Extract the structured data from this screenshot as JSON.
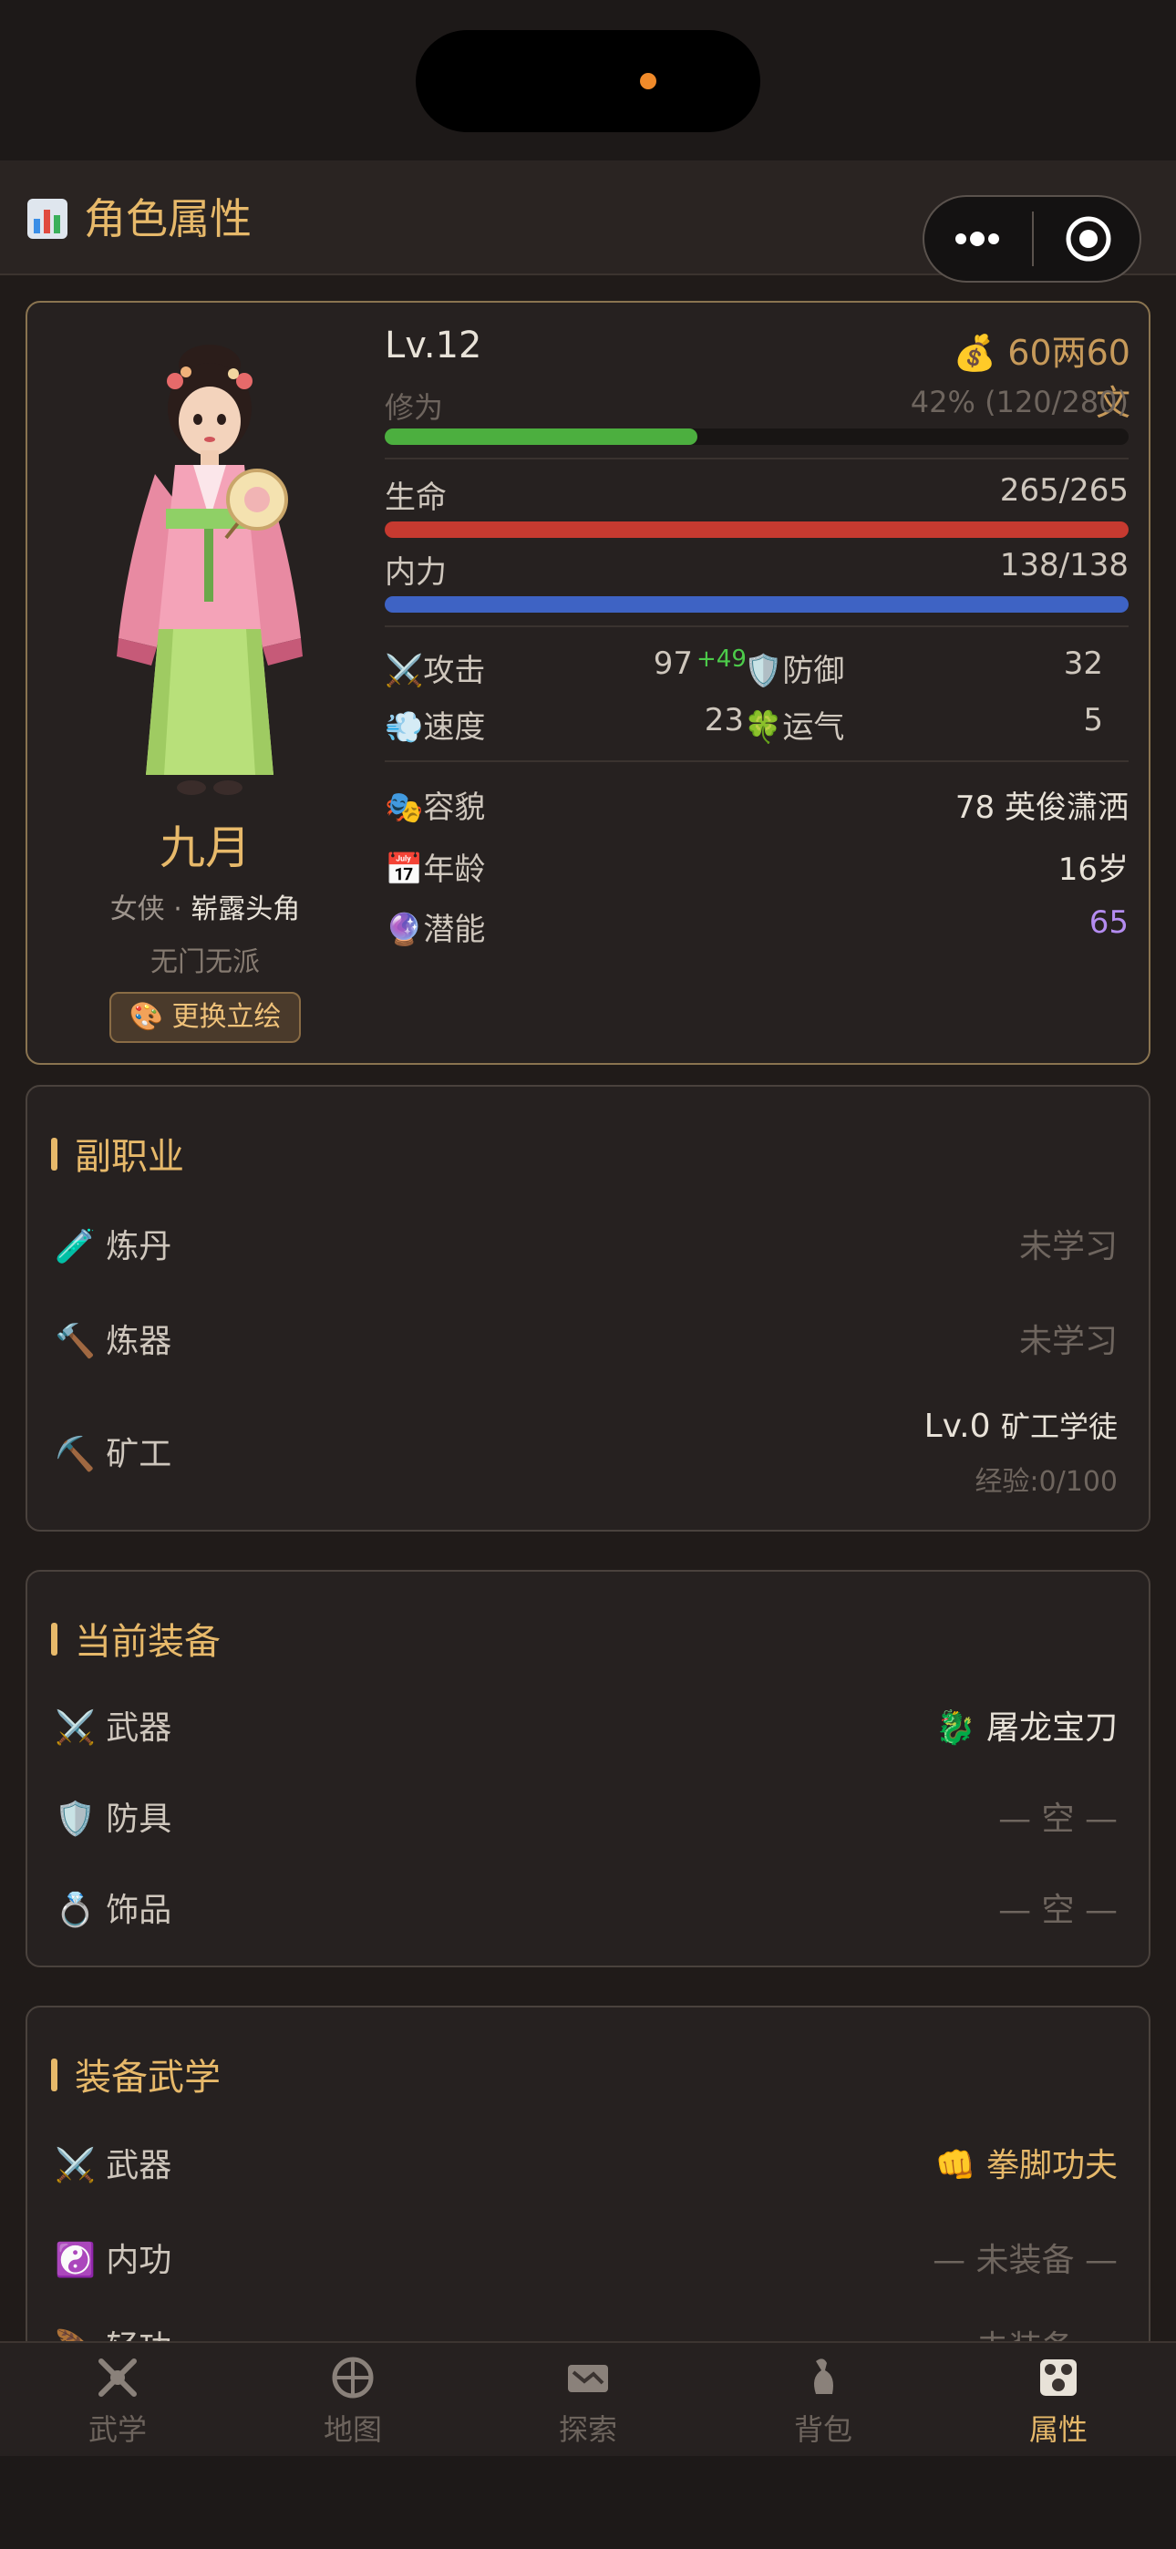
{
  "header": {
    "title": "角色属性"
  },
  "colors": {
    "accent": "#e7b96a",
    "xp_bar": "#4caf3f",
    "hp_bar": "#c63a30",
    "mp_bar": "#3e63c4",
    "potential": "#b48cf0",
    "bonus": "#4ccb4a"
  },
  "profile": {
    "name": "九月",
    "gender_title": "女侠",
    "rank_title": "崭露头角",
    "sect": "无门无派",
    "change_portrait_label": "更换立绘",
    "level": "Lv.12",
    "money": "60两60文",
    "cultivation_label": "修为",
    "cultivation_text": "42% (120/280)",
    "cultivation_fraction": 0.42,
    "hp_label": "生命",
    "hp_text": "265/265",
    "hp_fraction": 1.0,
    "mp_label": "内力",
    "mp_text": "138/138",
    "mp_fraction": 1.0,
    "attack_label": "攻击",
    "attack_value": "97",
    "attack_bonus": "+49",
    "defense_label": "防御",
    "defense_value": "32",
    "speed_label": "速度",
    "speed_value": "23",
    "luck_label": "运气",
    "luck_value": "5",
    "looks_label": "容貌",
    "looks_value": "78 英俊潇洒",
    "age_label": "年龄",
    "age_value": "16岁",
    "potential_label": "潜能",
    "potential_value": "65"
  },
  "side_jobs": {
    "title": "副职业",
    "items": [
      {
        "label": "炼丹",
        "value": "未学习",
        "icon": "potion-icon"
      },
      {
        "label": "炼器",
        "value": "未学习",
        "icon": "hammer-icon"
      },
      {
        "label": "矿工",
        "value": "Lv.0",
        "value_title": "矿工学徒",
        "sub": "经验:0/100",
        "icon": "pickaxe-icon"
      }
    ]
  },
  "equipment": {
    "title": "当前装备",
    "items": [
      {
        "label": "武器",
        "value": "屠龙宝刀",
        "icon": "crossed-swords-icon",
        "value_icon": "dragon-icon"
      },
      {
        "label": "防具",
        "value": "— 空 —",
        "icon": "shield-icon"
      },
      {
        "label": "饰品",
        "value": "— 空 —",
        "icon": "ring-icon"
      }
    ]
  },
  "martial": {
    "title": "装备武学",
    "items": [
      {
        "label": "武器",
        "value": "拳脚功夫",
        "icon": "crossed-swords-icon",
        "value_icon": "fist-icon"
      },
      {
        "label": "内功",
        "value": "— 未装备 —",
        "icon": "yin-yang-icon"
      },
      {
        "label": "轻功",
        "value": "— 未装备 —",
        "icon": "feather-icon"
      }
    ]
  },
  "nav": {
    "items": [
      {
        "label": "武学",
        "icon": "martial-icon"
      },
      {
        "label": "地图",
        "icon": "map-icon"
      },
      {
        "label": "探索",
        "icon": "explore-icon"
      },
      {
        "label": "背包",
        "icon": "bag-icon"
      },
      {
        "label": "属性",
        "icon": "attributes-icon",
        "active": true
      }
    ]
  }
}
